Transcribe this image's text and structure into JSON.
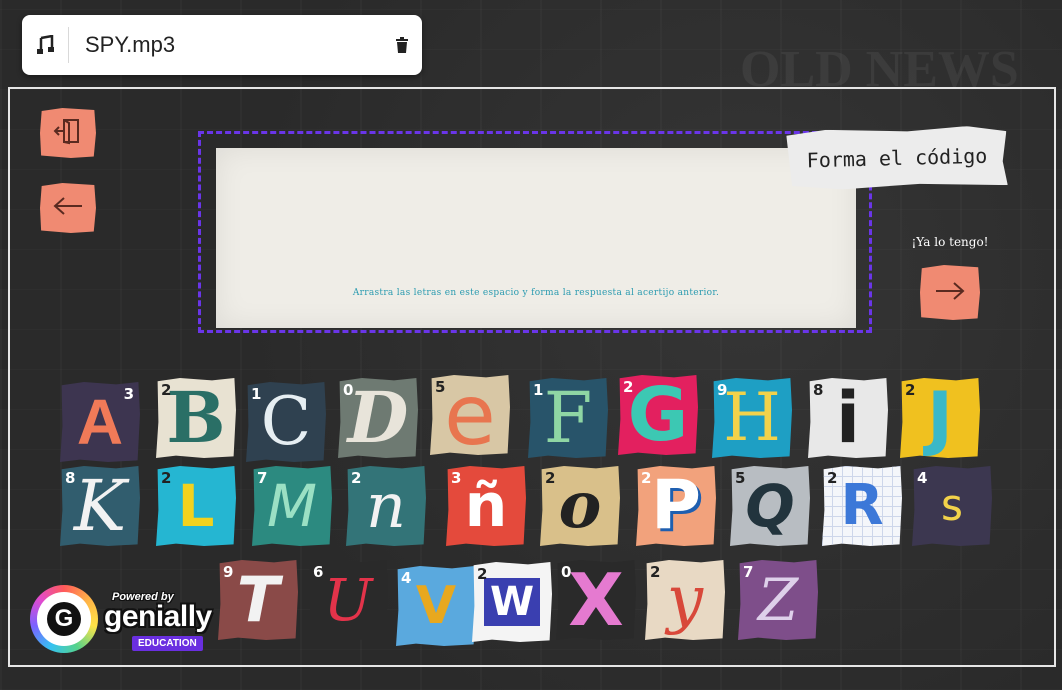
{
  "audio": {
    "file_name": "SPY.mp3",
    "music_icon": "music-note-icon",
    "delete_icon": "trash-icon"
  },
  "background": {
    "ghost_text": "OLD NEWS"
  },
  "nav": {
    "exit_icon": "exit-door-icon",
    "back_icon": "arrow-left-icon"
  },
  "puzzle": {
    "title": "Forma el código",
    "instruction": "Arrastra las letras en este espacio y forma la respuesta al acertijo anterior.",
    "submit_label": "¡Ya lo tengo!",
    "submit_icon": "arrow-right-icon",
    "drop_zone_color": "#6a35e8"
  },
  "letters": [
    {
      "char": "A",
      "num": "3"
    },
    {
      "char": "B",
      "num": "2"
    },
    {
      "char": "C",
      "num": "1"
    },
    {
      "char": "D",
      "num": "0"
    },
    {
      "char": "e",
      "num": "5"
    },
    {
      "char": "F",
      "num": "1"
    },
    {
      "char": "G",
      "num": "2"
    },
    {
      "char": "H",
      "num": "9"
    },
    {
      "char": "i",
      "num": "8"
    },
    {
      "char": "J",
      "num": "2"
    },
    {
      "char": "K",
      "num": "8"
    },
    {
      "char": "L",
      "num": "2"
    },
    {
      "char": "M",
      "num": "7"
    },
    {
      "char": "n",
      "num": "2"
    },
    {
      "char": "ñ",
      "num": "3"
    },
    {
      "char": "o",
      "num": "2"
    },
    {
      "char": "P",
      "num": "2"
    },
    {
      "char": "Q",
      "num": "5"
    },
    {
      "char": "R",
      "num": "2"
    },
    {
      "char": "s",
      "num": "4"
    },
    {
      "char": "T",
      "num": "9"
    },
    {
      "char": "U",
      "num": "6"
    },
    {
      "char": "V",
      "num": "4"
    },
    {
      "char": "W",
      "num": "2"
    },
    {
      "char": "X",
      "num": "0"
    },
    {
      "char": "y",
      "num": "2"
    },
    {
      "char": "Z",
      "num": "7"
    }
  ],
  "branding": {
    "powered_by": "Powered by",
    "name": "genially",
    "edition": "EDUCATION"
  },
  "colors": {
    "nav_button": "#f08a72",
    "accent_purple": "#6a2fe0"
  }
}
